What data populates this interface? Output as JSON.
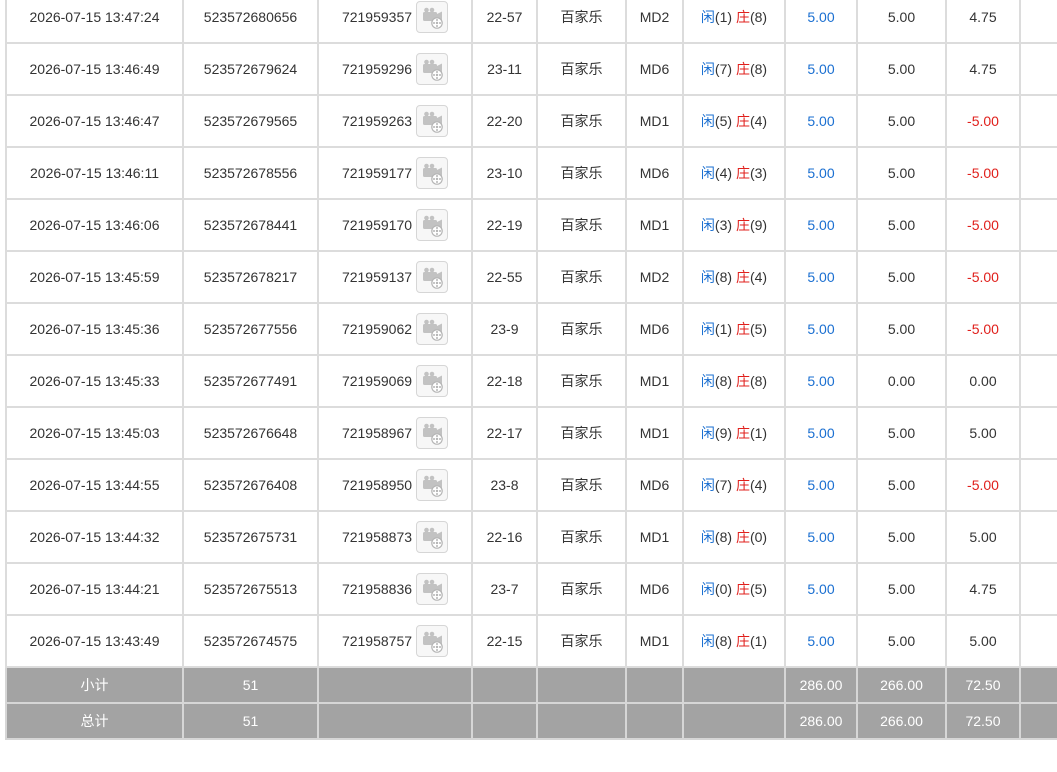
{
  "rows": [
    {
      "time": "2026-07-15 13:47:24",
      "bet_no": "523572680656",
      "round_no": "721959357",
      "table": "22-57",
      "game": "百家乐",
      "table_code": "MD2",
      "player_label": "闲",
      "player_score": "(1)",
      "banker_label": "庄",
      "banker_score": "(8)",
      "bet_amount": "5.00",
      "valid_amount": "5.00",
      "win_loss": "4.75",
      "negative": false
    },
    {
      "time": "2026-07-15 13:46:49",
      "bet_no": "523572679624",
      "round_no": "721959296",
      "table": "23-11",
      "game": "百家乐",
      "table_code": "MD6",
      "player_label": "闲",
      "player_score": "(7)",
      "banker_label": "庄",
      "banker_score": "(8)",
      "bet_amount": "5.00",
      "valid_amount": "5.00",
      "win_loss": "4.75",
      "negative": false
    },
    {
      "time": "2026-07-15 13:46:47",
      "bet_no": "523572679565",
      "round_no": "721959263",
      "table": "22-20",
      "game": "百家乐",
      "table_code": "MD1",
      "player_label": "闲",
      "player_score": "(5)",
      "banker_label": "庄",
      "banker_score": "(4)",
      "bet_amount": "5.00",
      "valid_amount": "5.00",
      "win_loss": "-5.00",
      "negative": true
    },
    {
      "time": "2026-07-15 13:46:11",
      "bet_no": "523572678556",
      "round_no": "721959177",
      "table": "23-10",
      "game": "百家乐",
      "table_code": "MD6",
      "player_label": "闲",
      "player_score": "(4)",
      "banker_label": "庄",
      "banker_score": "(3)",
      "bet_amount": "5.00",
      "valid_amount": "5.00",
      "win_loss": "-5.00",
      "negative": true
    },
    {
      "time": "2026-07-15 13:46:06",
      "bet_no": "523572678441",
      "round_no": "721959170",
      "table": "22-19",
      "game": "百家乐",
      "table_code": "MD1",
      "player_label": "闲",
      "player_score": "(3)",
      "banker_label": "庄",
      "banker_score": "(9)",
      "bet_amount": "5.00",
      "valid_amount": "5.00",
      "win_loss": "-5.00",
      "negative": true
    },
    {
      "time": "2026-07-15 13:45:59",
      "bet_no": "523572678217",
      "round_no": "721959137",
      "table": "22-55",
      "game": "百家乐",
      "table_code": "MD2",
      "player_label": "闲",
      "player_score": "(8)",
      "banker_label": "庄",
      "banker_score": "(4)",
      "bet_amount": "5.00",
      "valid_amount": "5.00",
      "win_loss": "-5.00",
      "negative": true
    },
    {
      "time": "2026-07-15 13:45:36",
      "bet_no": "523572677556",
      "round_no": "721959062",
      "table": "23-9",
      "game": "百家乐",
      "table_code": "MD6",
      "player_label": "闲",
      "player_score": "(1)",
      "banker_label": "庄",
      "banker_score": "(5)",
      "bet_amount": "5.00",
      "valid_amount": "5.00",
      "win_loss": "-5.00",
      "negative": true
    },
    {
      "time": "2026-07-15 13:45:33",
      "bet_no": "523572677491",
      "round_no": "721959069",
      "table": "22-18",
      "game": "百家乐",
      "table_code": "MD1",
      "player_label": "闲",
      "player_score": "(8)",
      "banker_label": "庄",
      "banker_score": "(8)",
      "bet_amount": "5.00",
      "valid_amount": "0.00",
      "win_loss": "0.00",
      "negative": false
    },
    {
      "time": "2026-07-15 13:45:03",
      "bet_no": "523572676648",
      "round_no": "721958967",
      "table": "22-17",
      "game": "百家乐",
      "table_code": "MD1",
      "player_label": "闲",
      "player_score": "(9)",
      "banker_label": "庄",
      "banker_score": "(1)",
      "bet_amount": "5.00",
      "valid_amount": "5.00",
      "win_loss": "5.00",
      "negative": false
    },
    {
      "time": "2026-07-15 13:44:55",
      "bet_no": "523572676408",
      "round_no": "721958950",
      "table": "23-8",
      "game": "百家乐",
      "table_code": "MD6",
      "player_label": "闲",
      "player_score": "(7)",
      "banker_label": "庄",
      "banker_score": "(4)",
      "bet_amount": "5.00",
      "valid_amount": "5.00",
      "win_loss": "-5.00",
      "negative": true
    },
    {
      "time": "2026-07-15 13:44:32",
      "bet_no": "523572675731",
      "round_no": "721958873",
      "table": "22-16",
      "game": "百家乐",
      "table_code": "MD1",
      "player_label": "闲",
      "player_score": "(8)",
      "banker_label": "庄",
      "banker_score": "(0)",
      "bet_amount": "5.00",
      "valid_amount": "5.00",
      "win_loss": "5.00",
      "negative": false
    },
    {
      "time": "2026-07-15 13:44:21",
      "bet_no": "523572675513",
      "round_no": "721958836",
      "table": "23-7",
      "game": "百家乐",
      "table_code": "MD6",
      "player_label": "闲",
      "player_score": "(0)",
      "banker_label": "庄",
      "banker_score": "(5)",
      "bet_amount": "5.00",
      "valid_amount": "5.00",
      "win_loss": "4.75",
      "negative": false
    },
    {
      "time": "2026-07-15 13:43:49",
      "bet_no": "523572674575",
      "round_no": "721958757",
      "table": "22-15",
      "game": "百家乐",
      "table_code": "MD1",
      "player_label": "闲",
      "player_score": "(8)",
      "banker_label": "庄",
      "banker_score": "(1)",
      "bet_amount": "5.00",
      "valid_amount": "5.00",
      "win_loss": "5.00",
      "negative": false
    }
  ],
  "subtotal": {
    "label": "小计",
    "count": "51",
    "bet_amount": "286.00",
    "valid_amount": "266.00",
    "win_loss": "72.50"
  },
  "total": {
    "label": "总计",
    "count": "51",
    "bet_amount": "286.00",
    "valid_amount": "266.00",
    "win_loss": "72.50"
  },
  "colors": {
    "player": "#1a6fd1",
    "banker": "#e0201c",
    "negative": "#e0201c",
    "summary_bg": "#a3a3a3",
    "grid": "#dcdcdc"
  },
  "icons": {
    "replay": "video-camera-icon"
  }
}
